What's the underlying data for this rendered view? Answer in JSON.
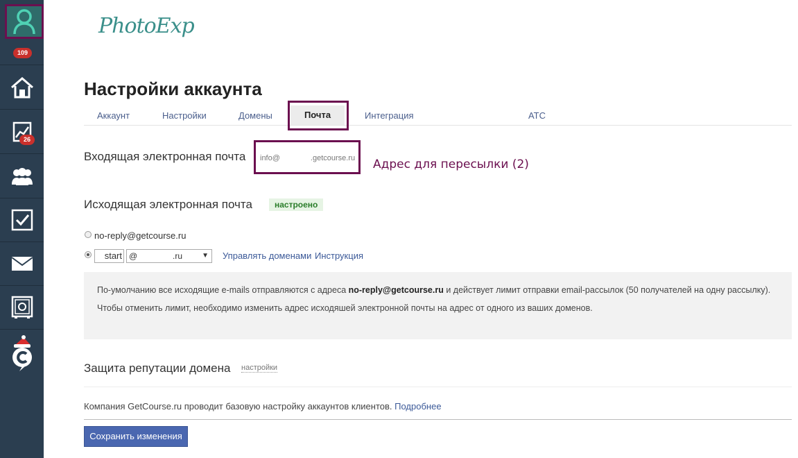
{
  "sidebar": {
    "profile_badge": "109",
    "stats_badge": "26",
    "items": [
      {
        "name": "profile",
        "icon": "user-icon"
      },
      {
        "name": "home",
        "icon": "home-icon"
      },
      {
        "name": "stats",
        "icon": "chart-icon"
      },
      {
        "name": "users",
        "icon": "group-icon"
      },
      {
        "name": "tasks",
        "icon": "checkbox-icon"
      },
      {
        "name": "mail",
        "icon": "mail-icon"
      },
      {
        "name": "safe",
        "icon": "safe-icon"
      },
      {
        "name": "getcourse",
        "icon": "getcourse-logo-icon"
      }
    ]
  },
  "logo_text": "PhotoExp",
  "page_title": "Настройки аккаунта",
  "tabs": [
    {
      "label": "Аккаунт"
    },
    {
      "label": "Настройки"
    },
    {
      "label": "Домены"
    },
    {
      "label": "Почта",
      "active": true
    },
    {
      "label": "Интеграция"
    },
    {
      "label": "АТС"
    }
  ],
  "incoming": {
    "label": "Входящая электронная почта",
    "email_prefix": "info@",
    "email_suffix": ".getcourse.ru",
    "annotation": "Адрес для пересылки (2)"
  },
  "outgoing": {
    "label": "Исходящая электронная почта",
    "status": "настроено",
    "option_default": "no-reply@getcourse.ru",
    "custom_local": "start",
    "custom_domain_prefix": "@",
    "custom_domain_suffix": ".ru",
    "manage_domains_link": "Управлять доменами",
    "instruction_link": "Инструкция"
  },
  "info": {
    "line1_before": "По-умолчанию все исходящие e-mails отправляются с адреса ",
    "line1_bold": "no-reply@getcourse.ru",
    "line1_after": " и действует лимит отправки email-рассылок (50 получателей на одну рассылку).",
    "line2": "Чтобы отменить лимит, необходимо изменить адрес исходяшей электронной почты на адрес от одного из ваших доменов."
  },
  "reputation": {
    "label": "Защита репутации домена",
    "settings_link": "настройки"
  },
  "footer_note": {
    "text": "Компания GetCourse.ru проводит базовую настройку аккаунтов клиентов. ",
    "link": "Подробнее"
  },
  "save_button": "Сохранить изменения",
  "colors": {
    "sidebar": "#2b3e50",
    "highlight": "#6b0f4f",
    "accent": "#4a67b0",
    "link": "#3b5998"
  }
}
